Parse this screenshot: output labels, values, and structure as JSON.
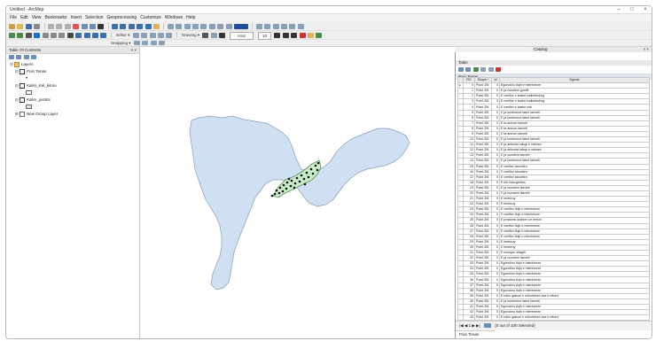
{
  "window": {
    "title": "Untitled - ArcMap",
    "minimize": "–",
    "maximize": "□",
    "close": "×"
  },
  "menu": [
    "File",
    "Edit",
    "View",
    "Bookmarks",
    "Insert",
    "Selection",
    "Geoprocessing",
    "Customize",
    "Windows",
    "Help"
  ],
  "toolbars": {
    "snapping_label": "Snapping ▾",
    "editor_label": "Editor ▾",
    "drawing_label": "Drawing ▾",
    "font_value": "Arial",
    "size_value": "10"
  },
  "toc": {
    "title": "Table Of Contents",
    "close": "× ×",
    "items": [
      {
        "label": "Layers",
        "indent": 0
      },
      {
        "label": "Poin Tenan",
        "indent": 1
      },
      {
        "label": "Kalim_Kel_kitoru",
        "indent": 1
      },
      {
        "label": "Kalim_jostrits",
        "indent": 1
      },
      {
        "label": "New Group Layer",
        "indent": 1
      }
    ]
  },
  "catalog": {
    "title": "Catalog",
    "close": "× ×"
  },
  "table": {
    "window_title": "Table",
    "tab": "Poin Tenan",
    "columns": [
      "FID",
      "Shape *",
      "Id",
      "Egonis"
    ],
    "rows": [
      {
        "fid": "0",
        "shape": "Point ZM",
        "id": "0",
        "name": "Egonolino tlujh e mlenheeze"
      },
      {
        "fid": "1",
        "shape": "Point ZM",
        "id": "0",
        "name": "E ja vsuntem gunifli"
      },
      {
        "fid": "2",
        "shape": "Point ZM",
        "id": "0",
        "name": "E venflez e kazim izalleeluding"
      },
      {
        "fid": "3",
        "shape": "Point ZM",
        "id": "0",
        "name": "E venflez e kazim izalleeluding"
      },
      {
        "fid": "4",
        "shape": "Point ZM",
        "id": "0",
        "name": "E venflez e kazim rosi"
      },
      {
        "fid": "5",
        "shape": "Point ZM",
        "id": "0",
        "name": "E ja lumbrorue tatmi laeneti"
      },
      {
        "fid": "6",
        "shape": "Point ZM",
        "id": "0",
        "name": "E ja lumbrorue tatmi laeneti"
      },
      {
        "fid": "7",
        "shape": "Point ZM",
        "id": "0",
        "name": "E ta anmon laeneti"
      },
      {
        "fid": "8",
        "shape": "Point ZM",
        "id": "0",
        "name": "E ta anmon laeneti"
      },
      {
        "fid": "9",
        "shape": "Point ZM",
        "id": "0",
        "name": "E ta anmon laeneti"
      },
      {
        "fid": "10",
        "shape": "Point ZM",
        "id": "0",
        "name": "E ja lumbrorue tatmi laeneti"
      },
      {
        "fid": "11",
        "shape": "Point ZM",
        "id": "0",
        "name": "E ja antiuniel ailugi e mlenza"
      },
      {
        "fid": "12",
        "shape": "Point ZM",
        "id": "0",
        "name": "E ja antiuniel ailugi e mlenza"
      },
      {
        "fid": "13",
        "shape": "Point ZM",
        "id": "0",
        "name": "E ja vsuntem laeneti"
      },
      {
        "fid": "14",
        "shape": "Point ZM",
        "id": "0",
        "name": "E ja lumbrorue tatmi laeneti"
      },
      {
        "fid": "15",
        "shape": "Point ZM",
        "id": "0",
        "name": "E venflez atourtien"
      },
      {
        "fid": "16",
        "shape": "Point ZM",
        "id": "0",
        "name": "E venflez atourtien"
      },
      {
        "fid": "17",
        "shape": "Point ZM",
        "id": "0",
        "name": "E venflez atourtien"
      },
      {
        "fid": "18",
        "shape": "Point ZM",
        "id": "0",
        "name": "E felt tiduzgrefiza"
      },
      {
        "fid": "19",
        "shape": "Point ZM",
        "id": "0",
        "name": "E ja vsuntem laeneti"
      },
      {
        "fid": "20",
        "shape": "Point ZM",
        "id": "0",
        "name": "E ja vsuntem laeneti"
      },
      {
        "fid": "21",
        "shape": "Point ZM",
        "id": "0",
        "name": "E lerebruy"
      },
      {
        "fid": "22",
        "shape": "Point ZM",
        "id": "0",
        "name": "E lerebruy"
      },
      {
        "fid": "23",
        "shape": "Point ZM",
        "id": "0",
        "name": "E venflez tlujh e mlenheeze"
      },
      {
        "fid": "24",
        "shape": "Point ZM",
        "id": "0",
        "name": "E venflez tlujh e mlenheeze"
      },
      {
        "fid": "25",
        "shape": "Point ZM",
        "id": "0",
        "name": "E pradonic azjestrr ue terrion"
      },
      {
        "fid": "26",
        "shape": "Point ZM",
        "id": "0",
        "name": "E venflez tlujh e mlenheeze"
      },
      {
        "fid": "27",
        "shape": "Point ZM",
        "id": "0",
        "name": "E venflez tlujh e mlenheeze"
      },
      {
        "fid": "28",
        "shape": "Point ZM",
        "id": "0",
        "name": "E venflez tlujh e mlenheeze"
      },
      {
        "fid": "29",
        "shape": "Point ZM",
        "id": "0",
        "name": "E lerebruy"
      },
      {
        "fid": "30",
        "shape": "Point ZM",
        "id": "0",
        "name": "E lerebruy"
      },
      {
        "fid": "31",
        "shape": "Point ZM",
        "id": "0",
        "name": "E mungon zdagiti"
      },
      {
        "fid": "32",
        "shape": "Point ZM",
        "id": "0",
        "name": "E ja vsuntem laeneti"
      },
      {
        "fid": "33",
        "shape": "Point ZM",
        "id": "0",
        "name": "Egonolino tlujh e mlenheeze"
      },
      {
        "fid": "34",
        "shape": "Point ZM",
        "id": "0",
        "name": "Egonolino tlujh e mlenheeze"
      },
      {
        "fid": "35",
        "shape": "Point ZM",
        "id": "0",
        "name": "Egonolino tlujh e mlenheeze"
      },
      {
        "fid": "36",
        "shape": "Point ZM",
        "id": "0",
        "name": "Egonolino tlujh e mlenheeze"
      },
      {
        "fid": "37",
        "shape": "Point ZM",
        "id": "0",
        "name": "Egonolino tlujh e mlenheeze"
      },
      {
        "fid": "38",
        "shape": "Point ZM",
        "id": "0",
        "name": "Egonolino tlujh e mlenheeze"
      },
      {
        "fid": "39",
        "shape": "Point ZM",
        "id": "0",
        "name": "E bahn galeze e mlenheeze aza e mbeni"
      },
      {
        "fid": "40",
        "shape": "Point ZM",
        "id": "0",
        "name": "E ja lumbrorue tatmi laeneti"
      },
      {
        "fid": "41",
        "shape": "Point ZM",
        "id": "0",
        "name": "Egonolino tlujh e mlenheeze"
      },
      {
        "fid": "42",
        "shape": "Point ZM",
        "id": "0",
        "name": "Egonolino tlujh e mlenheeze"
      },
      {
        "fid": "43",
        "shape": "Point ZM",
        "id": "0",
        "name": "E bahn galeze e mlenheeze aza e mbeni"
      }
    ],
    "footer_nav": "|◀  ◀  1  ▶  ▶|",
    "footer_status": "(0 out of 100 Selected)",
    "bottom_tab": "Poin Tenan"
  },
  "colors": {
    "polygon_fill": "#cfe0f3",
    "polygon_stroke": "#8a9db3",
    "cluster_fill": "#c9edc8",
    "accent": "#6b8fb8"
  }
}
